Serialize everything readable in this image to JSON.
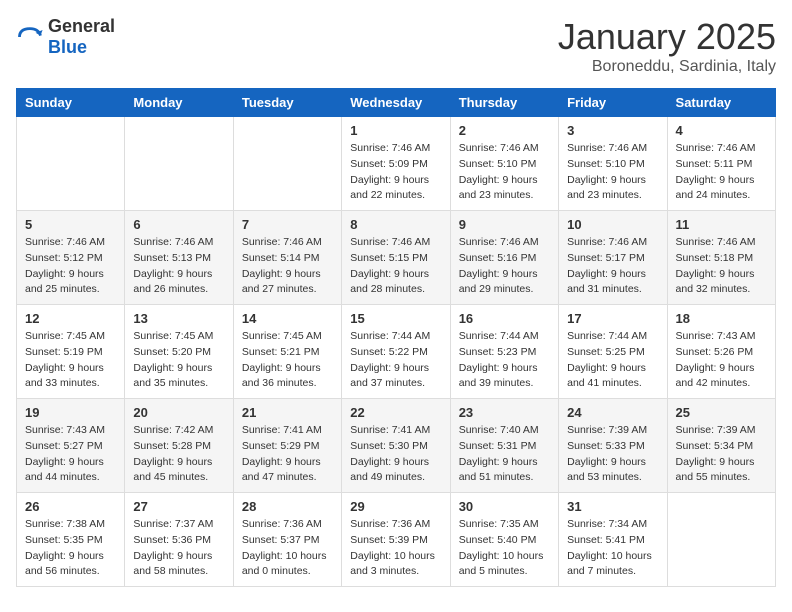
{
  "logo": {
    "general": "General",
    "blue": "Blue"
  },
  "header": {
    "month": "January 2025",
    "location": "Boroneddu, Sardinia, Italy"
  },
  "weekdays": [
    "Sunday",
    "Monday",
    "Tuesday",
    "Wednesday",
    "Thursday",
    "Friday",
    "Saturday"
  ],
  "weeks": [
    [
      {
        "day": "",
        "info": ""
      },
      {
        "day": "",
        "info": ""
      },
      {
        "day": "",
        "info": ""
      },
      {
        "day": "1",
        "info": "Sunrise: 7:46 AM\nSunset: 5:09 PM\nDaylight: 9 hours and 22 minutes."
      },
      {
        "day": "2",
        "info": "Sunrise: 7:46 AM\nSunset: 5:10 PM\nDaylight: 9 hours and 23 minutes."
      },
      {
        "day": "3",
        "info": "Sunrise: 7:46 AM\nSunset: 5:10 PM\nDaylight: 9 hours and 23 minutes."
      },
      {
        "day": "4",
        "info": "Sunrise: 7:46 AM\nSunset: 5:11 PM\nDaylight: 9 hours and 24 minutes."
      }
    ],
    [
      {
        "day": "5",
        "info": "Sunrise: 7:46 AM\nSunset: 5:12 PM\nDaylight: 9 hours and 25 minutes."
      },
      {
        "day": "6",
        "info": "Sunrise: 7:46 AM\nSunset: 5:13 PM\nDaylight: 9 hours and 26 minutes."
      },
      {
        "day": "7",
        "info": "Sunrise: 7:46 AM\nSunset: 5:14 PM\nDaylight: 9 hours and 27 minutes."
      },
      {
        "day": "8",
        "info": "Sunrise: 7:46 AM\nSunset: 5:15 PM\nDaylight: 9 hours and 28 minutes."
      },
      {
        "day": "9",
        "info": "Sunrise: 7:46 AM\nSunset: 5:16 PM\nDaylight: 9 hours and 29 minutes."
      },
      {
        "day": "10",
        "info": "Sunrise: 7:46 AM\nSunset: 5:17 PM\nDaylight: 9 hours and 31 minutes."
      },
      {
        "day": "11",
        "info": "Sunrise: 7:46 AM\nSunset: 5:18 PM\nDaylight: 9 hours and 32 minutes."
      }
    ],
    [
      {
        "day": "12",
        "info": "Sunrise: 7:45 AM\nSunset: 5:19 PM\nDaylight: 9 hours and 33 minutes."
      },
      {
        "day": "13",
        "info": "Sunrise: 7:45 AM\nSunset: 5:20 PM\nDaylight: 9 hours and 35 minutes."
      },
      {
        "day": "14",
        "info": "Sunrise: 7:45 AM\nSunset: 5:21 PM\nDaylight: 9 hours and 36 minutes."
      },
      {
        "day": "15",
        "info": "Sunrise: 7:44 AM\nSunset: 5:22 PM\nDaylight: 9 hours and 37 minutes."
      },
      {
        "day": "16",
        "info": "Sunrise: 7:44 AM\nSunset: 5:23 PM\nDaylight: 9 hours and 39 minutes."
      },
      {
        "day": "17",
        "info": "Sunrise: 7:44 AM\nSunset: 5:25 PM\nDaylight: 9 hours and 41 minutes."
      },
      {
        "day": "18",
        "info": "Sunrise: 7:43 AM\nSunset: 5:26 PM\nDaylight: 9 hours and 42 minutes."
      }
    ],
    [
      {
        "day": "19",
        "info": "Sunrise: 7:43 AM\nSunset: 5:27 PM\nDaylight: 9 hours and 44 minutes."
      },
      {
        "day": "20",
        "info": "Sunrise: 7:42 AM\nSunset: 5:28 PM\nDaylight: 9 hours and 45 minutes."
      },
      {
        "day": "21",
        "info": "Sunrise: 7:41 AM\nSunset: 5:29 PM\nDaylight: 9 hours and 47 minutes."
      },
      {
        "day": "22",
        "info": "Sunrise: 7:41 AM\nSunset: 5:30 PM\nDaylight: 9 hours and 49 minutes."
      },
      {
        "day": "23",
        "info": "Sunrise: 7:40 AM\nSunset: 5:31 PM\nDaylight: 9 hours and 51 minutes."
      },
      {
        "day": "24",
        "info": "Sunrise: 7:39 AM\nSunset: 5:33 PM\nDaylight: 9 hours and 53 minutes."
      },
      {
        "day": "25",
        "info": "Sunrise: 7:39 AM\nSunset: 5:34 PM\nDaylight: 9 hours and 55 minutes."
      }
    ],
    [
      {
        "day": "26",
        "info": "Sunrise: 7:38 AM\nSunset: 5:35 PM\nDaylight: 9 hours and 56 minutes."
      },
      {
        "day": "27",
        "info": "Sunrise: 7:37 AM\nSunset: 5:36 PM\nDaylight: 9 hours and 58 minutes."
      },
      {
        "day": "28",
        "info": "Sunrise: 7:36 AM\nSunset: 5:37 PM\nDaylight: 10 hours and 0 minutes."
      },
      {
        "day": "29",
        "info": "Sunrise: 7:36 AM\nSunset: 5:39 PM\nDaylight: 10 hours and 3 minutes."
      },
      {
        "day": "30",
        "info": "Sunrise: 7:35 AM\nSunset: 5:40 PM\nDaylight: 10 hours and 5 minutes."
      },
      {
        "day": "31",
        "info": "Sunrise: 7:34 AM\nSunset: 5:41 PM\nDaylight: 10 hours and 7 minutes."
      },
      {
        "day": "",
        "info": ""
      }
    ]
  ]
}
